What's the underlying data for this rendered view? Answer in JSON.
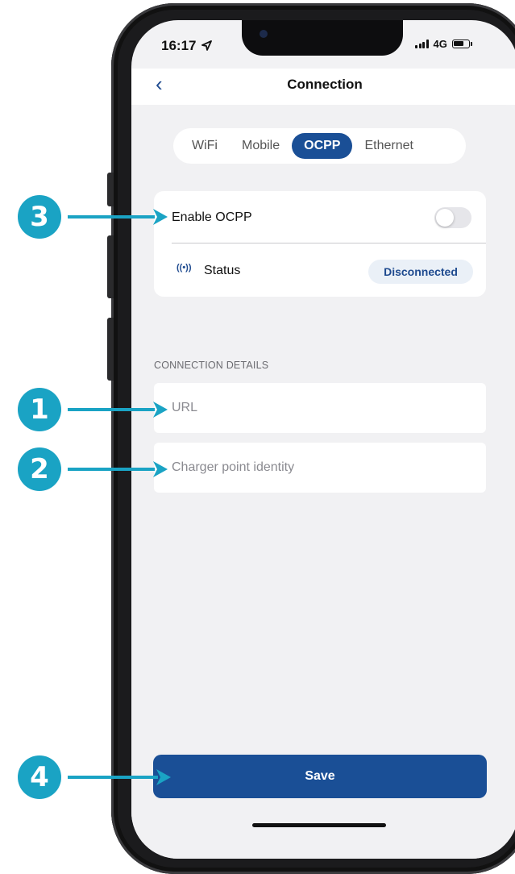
{
  "status_bar": {
    "time": "16:17",
    "network": "4G"
  },
  "header": {
    "title": "Connection",
    "back_icon": "chevron-left-icon"
  },
  "tabs": [
    {
      "label": "WiFi",
      "active": false
    },
    {
      "label": "Mobile",
      "active": false
    },
    {
      "label": "OCPP",
      "active": true
    },
    {
      "label": "Ethernet",
      "active": false
    }
  ],
  "ocpp_card": {
    "enable_label": "Enable OCPP",
    "enabled": false,
    "status_label": "Status",
    "status_value": "Disconnected"
  },
  "connection_details": {
    "section_label": "CONNECTION DETAILS",
    "url_placeholder": "URL",
    "url_value": "",
    "identity_placeholder": "Charger point identity",
    "identity_value": ""
  },
  "save_label": "Save",
  "annotations": [
    "1",
    "2",
    "3",
    "4"
  ],
  "colors": {
    "accent": "#1a4f96",
    "marker": "#1aa3c4",
    "background": "#f1f1f3"
  }
}
